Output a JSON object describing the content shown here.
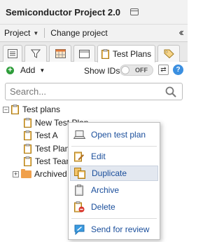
{
  "window": {
    "title": "Semiconductor Project 2.0"
  },
  "menubar": {
    "project_label": "Project",
    "change_project_label": "Change project"
  },
  "tabs": [
    {
      "icon": "list-icon"
    },
    {
      "icon": "filter-icon"
    },
    {
      "icon": "calendar-icon"
    },
    {
      "icon": "window-icon"
    },
    {
      "icon": "clipboard-icon",
      "label": "Test Plans"
    },
    {
      "icon": "tag-icon"
    }
  ],
  "toolbar": {
    "add_label": "Add",
    "show_ids_label": "Show IDs",
    "show_ids_state": "OFF"
  },
  "search": {
    "placeholder": "Search..."
  },
  "tree": {
    "root": {
      "label": "Test plans",
      "expander": "−"
    },
    "items": [
      {
        "label": "New Test Plan"
      },
      {
        "label": "Test A"
      },
      {
        "label": "Test Plan"
      },
      {
        "label": "Test Team"
      }
    ],
    "archived": {
      "label": "Archived plans",
      "expander": "+"
    }
  },
  "context_menu": {
    "items": [
      {
        "label": "Open test plan",
        "icon": "laptop-icon"
      },
      {
        "label": "Edit",
        "icon": "edit-icon"
      },
      {
        "label": "Duplicate",
        "icon": "duplicate-icon",
        "highlighted": true
      },
      {
        "label": "Archive",
        "icon": "archive-icon"
      },
      {
        "label": "Delete",
        "icon": "delete-icon"
      },
      {
        "label": "Send for review",
        "icon": "send-review-icon"
      }
    ]
  },
  "colors": {
    "accent_link": "#1a4e9b",
    "add_green": "#2e9d3a",
    "help_blue": "#3b8fe0",
    "folder_orange": "#f0a04b"
  }
}
